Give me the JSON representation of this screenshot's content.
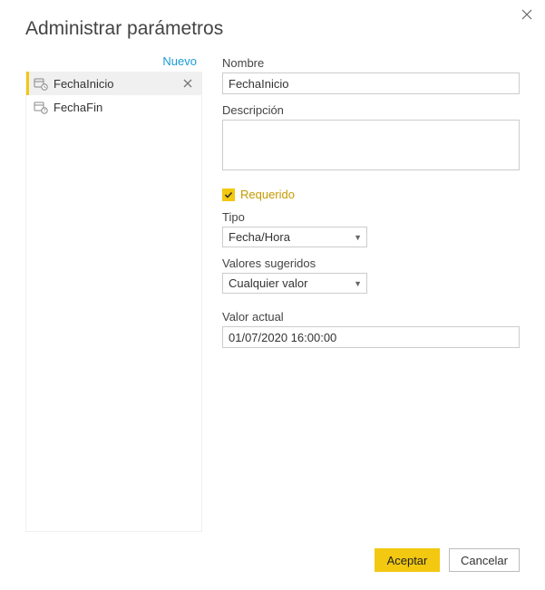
{
  "dialog": {
    "title": "Administrar parámetros",
    "newLink": "Nuevo"
  },
  "params": {
    "items": [
      {
        "name": "FechaInicio",
        "selected": true
      },
      {
        "name": "FechaFin",
        "selected": false
      }
    ]
  },
  "form": {
    "nombreLabel": "Nombre",
    "nombreValue": "FechaInicio",
    "descripcionLabel": "Descripción",
    "descripcionValue": "",
    "requeridoLabel": "Requerido",
    "requeridoChecked": true,
    "tipoLabel": "Tipo",
    "tipoValue": "Fecha/Hora",
    "valoresSugeridosLabel": "Valores sugeridos",
    "valoresSugeridosValue": "Cualquier valor",
    "valorActualLabel": "Valor actual",
    "valorActualValue": "01/07/2020 16:00:00"
  },
  "buttons": {
    "accept": "Aceptar",
    "cancel": "Cancelar"
  }
}
